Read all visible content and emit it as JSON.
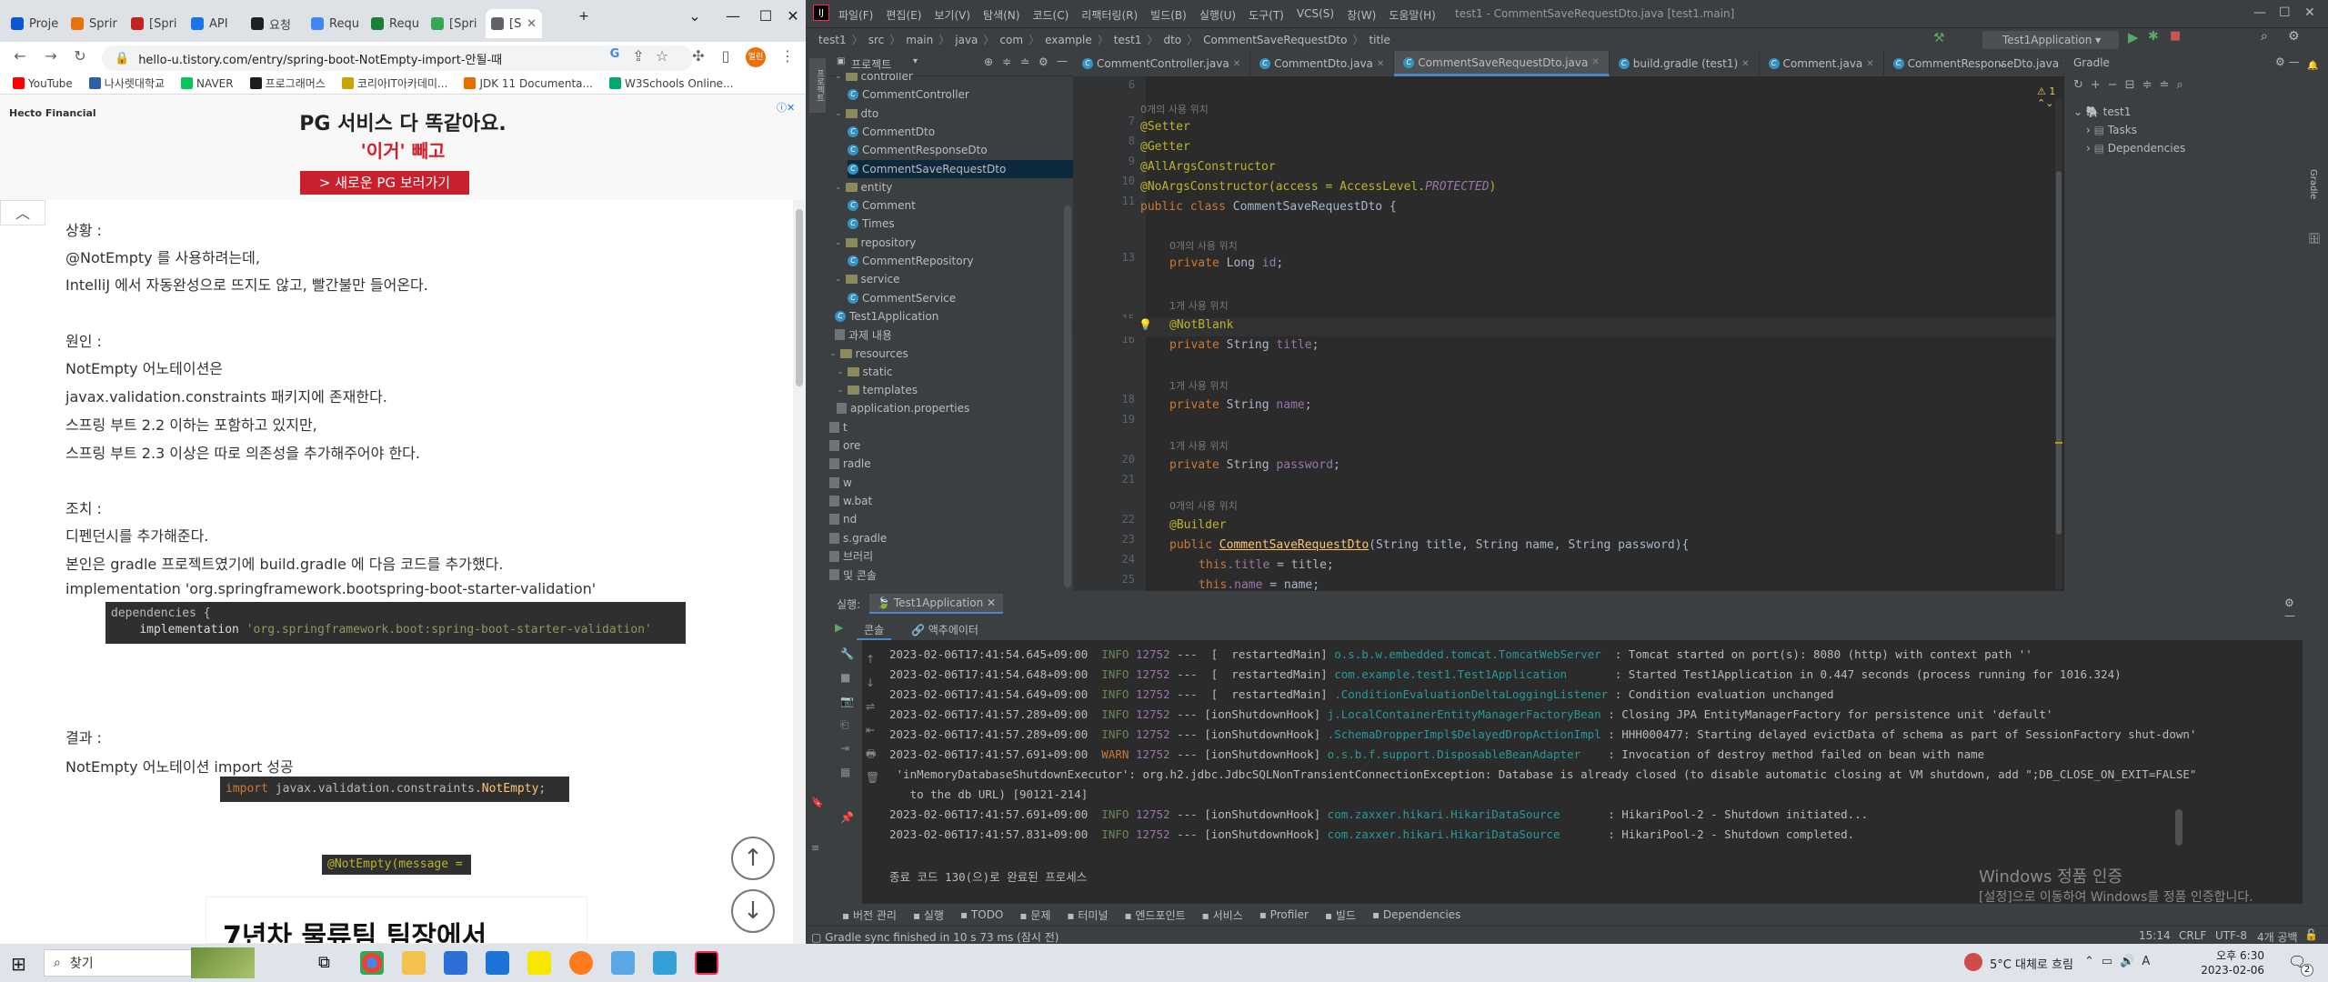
{
  "browser": {
    "tabs": [
      {
        "label": "Proje",
        "color": "#0b57d0"
      },
      {
        "label": "Sprir",
        "color": "#e8710a"
      },
      {
        "label": "[Spri",
        "color": "#c5221f"
      },
      {
        "label": "API",
        "color": "#1a73e8"
      },
      {
        "label": "요청",
        "color": "#202124"
      },
      {
        "label": "Requ",
        "color": "#4285f4"
      },
      {
        "label": "Requ",
        "color": "#188038"
      },
      {
        "label": "[Spri",
        "color": "#34a853"
      },
      {
        "label": "[S",
        "color": "#5f6368"
      }
    ],
    "url": "hello-u.tistory.com/entry/spring-boot-NotEmpty-import-안될-때",
    "profile": "멀린",
    "bookmarks": [
      {
        "label": "YouTube",
        "color": "#ff0000"
      },
      {
        "label": "나사렛대학교",
        "color": "#2f5fa7"
      },
      {
        "label": "NAVER",
        "color": "#03c75a"
      },
      {
        "label": "프로그래머스",
        "color": "#1e1e1e"
      },
      {
        "label": "코리아IT아카데미...",
        "color": "#c8a400"
      },
      {
        "label": "JDK 11 Documenta...",
        "color": "#e76f00"
      },
      {
        "label": "W3Schools Online...",
        "color": "#04aa6d"
      }
    ],
    "ad": {
      "brand": "Hecto Financial",
      "headline": "PG 서비스 다 똑같아요.",
      "highlight": "'이거' 빼고",
      "cta": "> 새로운 PG 보러가기"
    },
    "article": {
      "situation_title": "상황 :",
      "situation_1": "@NotEmpty 를 사용하려는데,",
      "situation_2": "IntelliJ 에서 자동완성으로 뜨지도 않고, 빨간불만 들어온다.",
      "cause_title": "원인 :",
      "cause_1": "NotEmpty 어노테이션은",
      "cause_2": "javax.validation.constraints 패키지에 존재한다.",
      "cause_3": "스프링 부트 2.2 이하는 포함하고 있지만,",
      "cause_4": "스프링 부트 2.3 이상은 따로 의존성을 추가해주어야 한다.",
      "action_title": "조치 :",
      "action_1": "디펜던시를 추가해준다.",
      "action_2": "본인은 gradle 프로젝트였기에 build.gradle 에 다음 코드를 추가했다.",
      "action_3": "implementation 'org.springframework.bootspring-boot-starter-validation'",
      "code1_line1": "dependencies {",
      "code1_kw": "implementation",
      "code1_str": "'org.springframework.boot:spring-boot-starter-validation'",
      "result_title": "결과 :",
      "result_1": "NotEmpty 어노테이션 import 성공",
      "code2_kw": "import",
      "code2_pkg": "javax.validation.constraints.",
      "code2_cls": "NotEmpty",
      "code3": "@NotEmpty(message =",
      "bottom_ad": "7년차 물류팀 팀장에서"
    }
  },
  "ide": {
    "menu": [
      "파일(F)",
      "편집(E)",
      "보기(V)",
      "탐색(N)",
      "코드(C)",
      "리팩터링(R)",
      "빌드(B)",
      "실행(U)",
      "도구(T)",
      "VCS(S)",
      "창(W)",
      "도움말(H)"
    ],
    "title": "test1 - CommentSaveRequestDto.java [test1.main]",
    "breadcrumb": [
      "test1",
      "src",
      "main",
      "java",
      "com",
      "example",
      "test1",
      "dto",
      "CommentSaveRequestDto",
      "title"
    ],
    "run_config": "Test1Application",
    "project_label": "프로젝트",
    "tree": [
      {
        "label": "controller",
        "kind": "folder",
        "indent": 0
      },
      {
        "label": "CommentController",
        "kind": "class",
        "indent": 1
      },
      {
        "label": "dto",
        "kind": "folder",
        "indent": 0
      },
      {
        "label": "CommentDto",
        "kind": "class",
        "indent": 1
      },
      {
        "label": "CommentResponseDto",
        "kind": "class",
        "indent": 1
      },
      {
        "label": "CommentSaveRequestDto",
        "kind": "class",
        "indent": 1
      },
      {
        "label": "entity",
        "kind": "folder",
        "indent": 0
      },
      {
        "label": "Comment",
        "kind": "class",
        "indent": 1
      },
      {
        "label": "Times",
        "kind": "class",
        "indent": 1
      },
      {
        "label": "repository",
        "kind": "folder",
        "indent": 0
      },
      {
        "label": "CommentRepository",
        "kind": "class",
        "indent": 1
      },
      {
        "label": "service",
        "kind": "folder",
        "indent": 0
      },
      {
        "label": "CommentService",
        "kind": "class",
        "indent": 1
      },
      {
        "label": "Test1Application",
        "kind": "class",
        "indent": 0
      },
      {
        "label": "과제 내용",
        "kind": "file",
        "indent": 0
      },
      {
        "label": "resources",
        "kind": "folder",
        "indent": -2
      },
      {
        "label": "static",
        "kind": "folder",
        "indent": -1
      },
      {
        "label": "templates",
        "kind": "folder",
        "indent": -1
      },
      {
        "label": "application.properties",
        "kind": "file",
        "indent": -1
      },
      {
        "label": "t",
        "kind": "file",
        "indent": -2
      },
      {
        "label": "ore",
        "kind": "file",
        "indent": -2
      },
      {
        "label": "radle",
        "kind": "file",
        "indent": -2
      },
      {
        "label": "w",
        "kind": "file",
        "indent": -2
      },
      {
        "label": "w.bat",
        "kind": "file",
        "indent": -2
      },
      {
        "label": "nd",
        "kind": "file",
        "indent": -2
      },
      {
        "label": "s.gradle",
        "kind": "file",
        "indent": -2
      },
      {
        "label": "브러리",
        "kind": "file",
        "indent": -2
      },
      {
        "label": "및 콘솔",
        "kind": "file",
        "indent": -2
      }
    ],
    "editor_tabs": [
      {
        "label": "CommentController.java",
        "active": false
      },
      {
        "label": "CommentDto.java",
        "active": false
      },
      {
        "label": "CommentSaveRequestDto.java",
        "active": true
      },
      {
        "label": "build.gradle (test1)",
        "active": false
      },
      {
        "label": "Comment.java",
        "active": false
      },
      {
        "label": "CommentResponseDto.java",
        "active": false
      }
    ],
    "warning_count": "1",
    "code": {
      "hint0": "0개의 사용 위치",
      "l7": "@Setter",
      "l8": "@Getter",
      "l9": "@AllArgsConstructor",
      "l10_a": "@NoArgsConstructor(access = AccessLevel.",
      "l10_b": "PROTECTED",
      "l10_c": ")",
      "l11_kw": "public class ",
      "l11_name": "CommentSaveRequestDto {",
      "hint_id": "0개의 사용 위치",
      "l13_kw": "private ",
      "l13_type": "Long ",
      "l13_f": "id",
      "hint_title": "1개 사용 위치",
      "l15": "@NotBlank",
      "l16_kw": "private ",
      "l16_type": "String ",
      "l16_f": "title",
      "hint_name": "1개 사용 위치",
      "l18_kw": "private ",
      "l18_type": "String ",
      "l18_f": "name",
      "hint_pw": "1개 사용 위치",
      "l20_kw": "private ",
      "l20_type": "String ",
      "l20_f": "password",
      "hint_ctor": "0개의 사용 위치",
      "l22": "@Builder",
      "l23_kw": "public ",
      "l23_name": "CommentSaveRequestDto",
      "l23_rest": "(String title, String name, String password){",
      "l24_kw": "this",
      "l24_f": ".title",
      "l24_rest": " = title;",
      "l25_kw": "this",
      "l25_f": ".name",
      "l25_rest": " = name;"
    },
    "line_numbers": [
      "6",
      "7",
      "8",
      "9",
      "10",
      "11",
      "13",
      "15",
      "16",
      "18",
      "19",
      "20",
      "21",
      "22",
      "23",
      "24",
      "25"
    ],
    "gradle": {
      "title": "Gradle",
      "root": "test1",
      "children": [
        "Tasks",
        "Dependencies"
      ]
    },
    "run": {
      "label": "실행:",
      "config": "Test1Application",
      "tab_console": "콘솔",
      "tab_actuator": "액추에이터"
    },
    "logs": [
      {
        "time": "2023-02-06T17:41:54.645+09:00",
        "level": "INFO",
        "pid": "12752",
        "thread": "---  [  restartedMain]",
        "logger": "o.s.b.w.embedded.tomcat.TomcatWebServer ",
        "msg": ": Tomcat started on port(s): 8080 (http) with context path ''"
      },
      {
        "time": "2023-02-06T17:41:54.648+09:00",
        "level": "INFO",
        "pid": "12752",
        "thread": "---  [  restartedMain]",
        "logger": "com.example.test1.Test1Application      ",
        "msg": ": Started Test1Application in 0.447 seconds (process running for 1016.324)"
      },
      {
        "time": "2023-02-06T17:41:54.649+09:00",
        "level": "INFO",
        "pid": "12752",
        "thread": "---  [  restartedMain]",
        "logger": ".ConditionEvaluationDeltaLoggingListener",
        "msg": ": Condition evaluation unchanged"
      },
      {
        "time": "2023-02-06T17:41:57.289+09:00",
        "level": "INFO",
        "pid": "12752",
        "thread": "--- [ionShutdownHook]",
        "logger": "j.LocalContainerEntityManagerFactoryBean",
        "msg": ": Closing JPA EntityManagerFactory for persistence unit 'default'"
      },
      {
        "time": "2023-02-06T17:41:57.289+09:00",
        "level": "INFO",
        "pid": "12752",
        "thread": "--- [ionShutdownHook]",
        "logger": ".SchemaDropperImpl$DelayedDropActionImpl",
        "msg": ": HHH000477: Starting delayed evictData of schema as part of SessionFactory shut-down'"
      },
      {
        "time": "2023-02-06T17:41:57.691+09:00",
        "level": "WARN",
        "pid": "12752",
        "thread": "--- [ionShutdownHook]",
        "logger": "o.s.b.f.support.DisposableBeanAdapter   ",
        "msg": ": Invocation of destroy method failed on bean with name"
      },
      {
        "time": "",
        "level": "",
        "pid": "",
        "thread": "",
        "logger": "",
        "msg": " 'inMemoryDatabaseShutdownExecutor': org.h2.jdbc.JdbcSQLNonTransientConnectionException: Database is already closed (to disable automatic closing at VM shutdown, add \";DB_CLOSE_ON_EXIT=FALSE\""
      },
      {
        "time": "",
        "level": "",
        "pid": "",
        "thread": "",
        "logger": "",
        "msg": "   to the db URL) [90121-214]"
      },
      {
        "time": "2023-02-06T17:41:57.691+09:00",
        "level": "INFO",
        "pid": "12752",
        "thread": "--- [ionShutdownHook]",
        "logger": "com.zaxxer.hikari.HikariDataSource      ",
        "msg": ": HikariPool-2 - Shutdown initiated..."
      },
      {
        "time": "2023-02-06T17:41:57.831+09:00",
        "level": "INFO",
        "pid": "12752",
        "thread": "--- [ionShutdownHook]",
        "logger": "com.zaxxer.hikari.HikariDataSource      ",
        "msg": ": HikariPool-2 - Shutdown completed."
      }
    ],
    "exit_msg": "종료 코드 130(으)로 완료된 프로세스",
    "activation_title": "Windows 정품 인증",
    "activation_sub": "[설정]으로 이동하여 Windows를 정품 인증합니다.",
    "toolwins": [
      "버전 관리",
      "실행",
      "TODO",
      "문제",
      "터미널",
      "엔드포인트",
      "서비스",
      "Profiler",
      "빌드",
      "Dependencies"
    ],
    "status_left": "Gradle sync finished in 10 s 73 ms (잠시 전)",
    "status_right": [
      "15:14",
      "CRLF",
      "UTF-8",
      "4개 공백"
    ]
  },
  "taskbar": {
    "search": "찾기",
    "weather": "5°C 대체로 흐림",
    "time": "오후 6:30",
    "date": "2023-02-06",
    "notifications": "2"
  }
}
